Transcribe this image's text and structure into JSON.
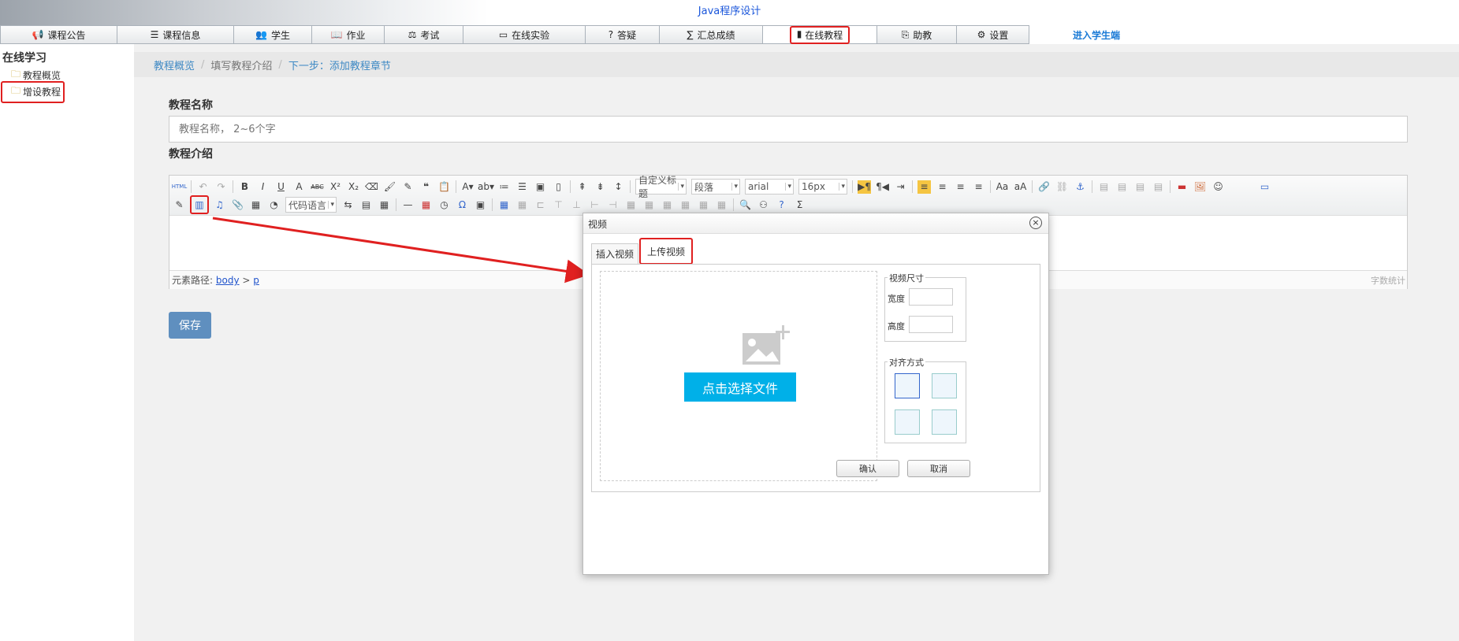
{
  "header": {
    "title": "Java程序设计"
  },
  "nav": [
    {
      "label": "课程公告",
      "icon": "megaphone-icon",
      "glyph": "📢"
    },
    {
      "label": "课程信息",
      "icon": "list-icon",
      "glyph": "☰"
    },
    {
      "label": "学生",
      "icon": "users-icon",
      "glyph": "👥"
    },
    {
      "label": "作业",
      "icon": "book-icon",
      "glyph": "📖"
    },
    {
      "label": "考试",
      "icon": "exam-icon",
      "glyph": "⚖"
    },
    {
      "label": "在线实验",
      "icon": "monitor-icon",
      "glyph": "▭"
    },
    {
      "label": "答疑",
      "icon": "question-icon",
      "glyph": "?"
    },
    {
      "label": "汇总成绩",
      "icon": "sigma-icon",
      "glyph": "∑"
    },
    {
      "label": "在线教程",
      "icon": "book-icon",
      "glyph": "▮"
    },
    {
      "label": "助教",
      "icon": "assistant-icon",
      "glyph": "⎘"
    },
    {
      "label": "设置",
      "icon": "gear-icon",
      "glyph": "⚙"
    },
    {
      "label": "进入学生端",
      "icon": "",
      "glyph": ""
    }
  ],
  "sidebar": {
    "title": "在线学习",
    "items": [
      {
        "label": "教程概览",
        "icon": "folder-icon"
      },
      {
        "label": "增设教程",
        "icon": "folder-icon"
      }
    ]
  },
  "breadcrumb": {
    "step1": "教程概览",
    "step2": "填写教程介绍",
    "step3": "下一步：添加教程章节"
  },
  "form": {
    "name_label": "教程名称",
    "name_placeholder": "教程名称， 2~6个字",
    "intro_label": "教程介绍",
    "save_label": "保存"
  },
  "editor": {
    "heading_select": "自定义标题",
    "paragraph_select": "段落",
    "font_select": "arial",
    "size_select": "16px",
    "code_select": "代码语言",
    "path_label": "元素路径:",
    "path_body": "body",
    "path_sep": ">",
    "path_p": "p",
    "word_count": "字数统计"
  },
  "dialog": {
    "title": "视频",
    "tab_insert": "插入视频",
    "tab_upload": "上传视频",
    "choose_label": "点击选择文件",
    "size_legend": "视频尺寸",
    "width_label": "宽度",
    "height_label": "高度",
    "align_legend": "对齐方式",
    "ok_label": "确认",
    "cancel_label": "取消"
  },
  "colors": {
    "accent": "#1a56db",
    "highlight": "#e02020",
    "upload_btn": "#00b0e8",
    "save_btn": "#5f8fbf"
  }
}
